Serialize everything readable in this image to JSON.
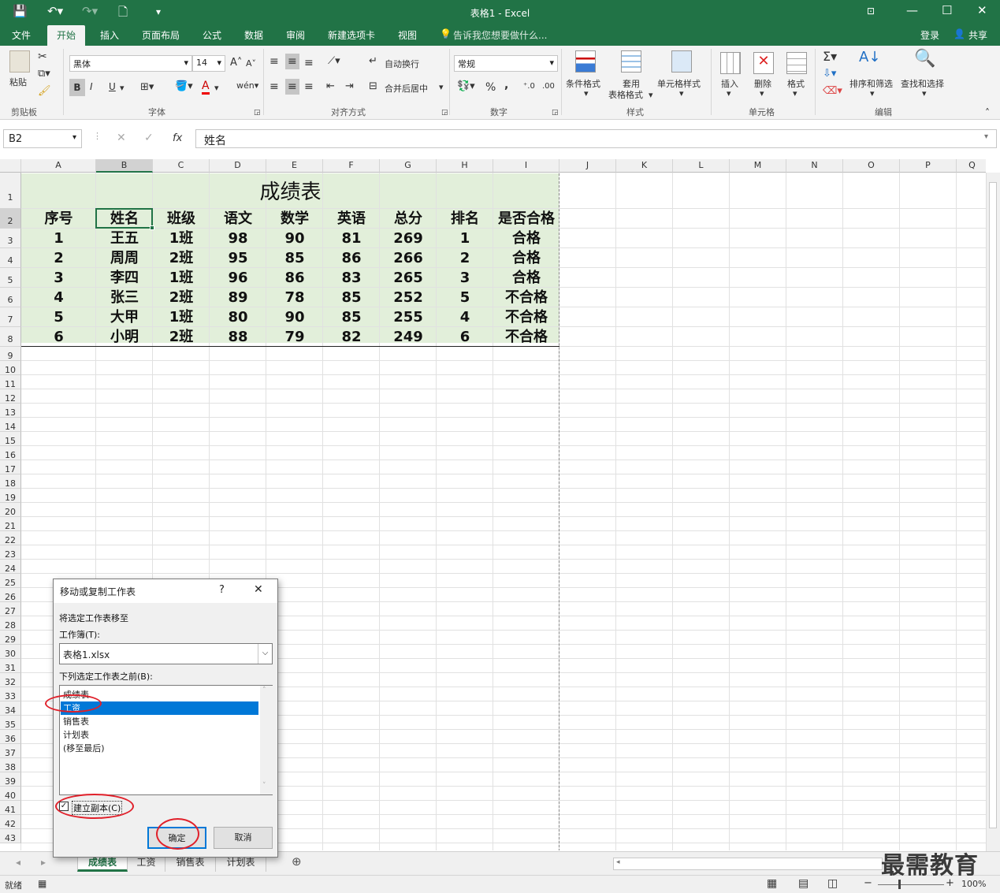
{
  "window": {
    "title": "表格1 - Excel"
  },
  "menu": {
    "tabs": [
      "文件",
      "开始",
      "插入",
      "页面布局",
      "公式",
      "数据",
      "审阅",
      "新建选项卡",
      "视图"
    ],
    "active": "开始",
    "tell_me": "告诉我您想要做什么...",
    "login": "登录",
    "share": "共享"
  },
  "ribbon": {
    "clipboard": {
      "paste": "粘贴",
      "group": "剪贴板"
    },
    "font": {
      "name": "黑体",
      "size": "14",
      "group": "字体",
      "bold": "B",
      "italic": "I",
      "underline": "U"
    },
    "align": {
      "wrap": "自动换行",
      "merge": "合并后居中",
      "group": "对齐方式"
    },
    "number": {
      "format": "常规",
      "group": "数字",
      "percent": "%",
      "comma": ","
    },
    "styles": {
      "cond": "条件格式",
      "table1": "套用",
      "table2": "表格格式",
      "cell": "单元格样式",
      "group": "样式"
    },
    "cells": {
      "insert": "插入",
      "delete": "删除",
      "format": "格式",
      "group": "单元格"
    },
    "edit": {
      "sort": "排序和筛选",
      "find": "查找和选择",
      "group": "编辑"
    }
  },
  "formula": {
    "namebox": "B2",
    "fx": "fx",
    "content": "姓名"
  },
  "columns": [
    "A",
    "B",
    "C",
    "D",
    "E",
    "F",
    "G",
    "H",
    "I",
    "J",
    "K",
    "L",
    "M",
    "N",
    "O",
    "P",
    "Q"
  ],
  "rows": [
    "1",
    "2",
    "3",
    "4",
    "5",
    "6",
    "7",
    "8",
    "9",
    "10",
    "11",
    "12",
    "13",
    "14",
    "15",
    "16",
    "17",
    "18",
    "19",
    "20",
    "21",
    "22",
    "23",
    "24",
    "25",
    "26",
    "27",
    "28",
    "29",
    "30",
    "31",
    "32",
    "33",
    "34",
    "35",
    "36",
    "37",
    "38",
    "39",
    "40",
    "41",
    "42",
    "43"
  ],
  "sheet": {
    "title": "成绩表",
    "headers": [
      "序号",
      "姓名",
      "班级",
      "语文",
      "数学",
      "英语",
      "总分",
      "排名",
      "是否合格"
    ],
    "data": [
      [
        "1",
        "王五",
        "1班",
        "98",
        "90",
        "81",
        "269",
        "1",
        "合格"
      ],
      [
        "2",
        "周周",
        "2班",
        "95",
        "85",
        "86",
        "266",
        "2",
        "合格"
      ],
      [
        "3",
        "李四",
        "1班",
        "96",
        "86",
        "83",
        "265",
        "3",
        "合格"
      ],
      [
        "4",
        "张三",
        "2班",
        "89",
        "78",
        "85",
        "252",
        "5",
        "不合格"
      ],
      [
        "5",
        "大甲",
        "1班",
        "80",
        "90",
        "85",
        "255",
        "4",
        "不合格"
      ],
      [
        "6",
        "小明",
        "2班",
        "88",
        "79",
        "82",
        "249",
        "6",
        "不合格"
      ]
    ]
  },
  "sheet_tabs": [
    "成绩表",
    "工资",
    "销售表",
    "计划表"
  ],
  "active_sheet": "成绩表",
  "status": {
    "ready": "就绪",
    "zoom": "100%"
  },
  "dialog": {
    "title": "移动或复制工作表",
    "help": "?",
    "close": "✕",
    "move_to": "将选定工作表移至",
    "workbook_label": "工作簿(T):",
    "workbook_value": "表格1.xlsx",
    "before_label": "下列选定工作表之前(B):",
    "list": [
      "成绩表",
      "工资",
      "销售表",
      "计划表",
      "(移至最后)"
    ],
    "selected": "工资",
    "copy_label": "建立副本(C)",
    "copy_checked": true,
    "ok": "确定",
    "cancel": "取消"
  },
  "watermark": "最需教育",
  "colors": {
    "excel_green": "#217346",
    "table_fill": "#e2efda",
    "selection": "#0078d7",
    "annotation": "#e0202a"
  }
}
